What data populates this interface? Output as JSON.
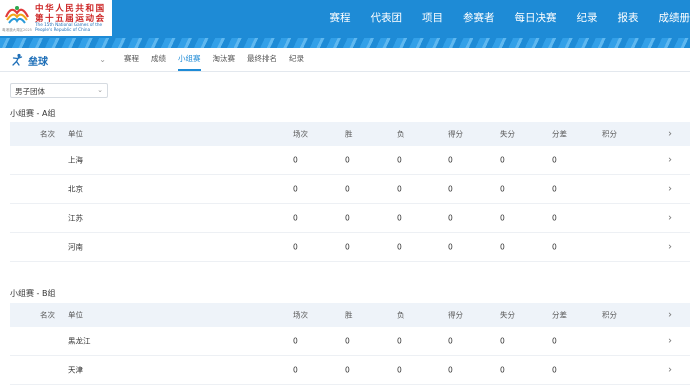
{
  "header": {
    "logo": {
      "cn_line1": "中华人民共和国",
      "cn_line2": "第十五届运动会",
      "en_line": "The 15th National Games of the People's Republic of China",
      "small_text": "粤港澳大湾区2025"
    },
    "nav": [
      "赛程",
      "代表团",
      "项目",
      "参赛者",
      "每日决赛",
      "纪录",
      "报表",
      "成绩册"
    ]
  },
  "sport": {
    "name": "垒球",
    "icon": "softball-player-icon"
  },
  "tabs": [
    {
      "label": "赛程",
      "active": false
    },
    {
      "label": "成绩",
      "active": false
    },
    {
      "label": "小组赛",
      "active": true
    },
    {
      "label": "淘汰赛",
      "active": false
    },
    {
      "label": "最终排名",
      "active": false
    },
    {
      "label": "纪录",
      "active": false
    }
  ],
  "filter": {
    "value": "男子团体"
  },
  "columns": {
    "rank": "名次",
    "team": "单位",
    "played": "场次",
    "win": "胜",
    "lose": "负",
    "gf": "得分",
    "ga": "失分",
    "gd": "分差",
    "pts": "积分"
  },
  "groups": [
    {
      "title": "小组赛 - A组",
      "rows": [
        {
          "rank": "",
          "team": "上海",
          "played": "0",
          "win": "0",
          "lose": "0",
          "gf": "0",
          "ga": "0",
          "gd": "0",
          "pts": ""
        },
        {
          "rank": "",
          "team": "北京",
          "played": "0",
          "win": "0",
          "lose": "0",
          "gf": "0",
          "ga": "0",
          "gd": "0",
          "pts": ""
        },
        {
          "rank": "",
          "team": "江苏",
          "played": "0",
          "win": "0",
          "lose": "0",
          "gf": "0",
          "ga": "0",
          "gd": "0",
          "pts": ""
        },
        {
          "rank": "",
          "team": "河南",
          "played": "0",
          "win": "0",
          "lose": "0",
          "gf": "0",
          "ga": "0",
          "gd": "0",
          "pts": ""
        }
      ]
    },
    {
      "title": "小组赛 - B组",
      "rows": [
        {
          "rank": "",
          "team": "黑龙江",
          "played": "0",
          "win": "0",
          "lose": "0",
          "gf": "0",
          "ga": "0",
          "gd": "0",
          "pts": ""
        },
        {
          "rank": "",
          "team": "天津",
          "played": "0",
          "win": "0",
          "lose": "0",
          "gf": "0",
          "ga": "0",
          "gd": "0",
          "pts": ""
        }
      ]
    }
  ],
  "colors": {
    "header_blue": "#1e8bd6",
    "active_tab": "#1e8bd6",
    "table_header_bg": "#eef3f9",
    "logo_red": "#cc2222"
  }
}
